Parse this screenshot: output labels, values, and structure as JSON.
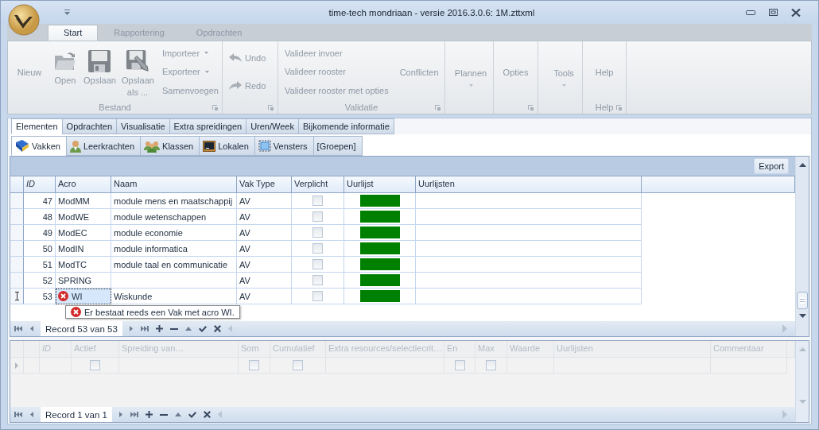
{
  "window": {
    "title": "time-tech mondriaan - versie 2016.3.0.6: 1M.zttxml"
  },
  "ribbon": {
    "tabs": [
      {
        "label": "Start",
        "selected": true
      },
      {
        "label": "Rapportering",
        "selected": false
      },
      {
        "label": "Opdrachten",
        "selected": false
      }
    ],
    "groups": [
      {
        "caption": "Bestand",
        "launcher": true,
        "columns": [
          [
            {
              "kind": "text",
              "label": "Nieuw"
            }
          ],
          [
            {
              "kind": "large",
              "label": "Open"
            }
          ],
          [
            {
              "kind": "large",
              "label": "Opslaan"
            }
          ],
          [
            {
              "kind": "large",
              "label": "Opslaan als ..."
            }
          ],
          [
            {
              "kind": "menu",
              "label": "Importeer"
            },
            {
              "kind": "menu",
              "label": "Exporteer"
            },
            {
              "kind": "small",
              "label": "Samenvoegen"
            }
          ]
        ]
      },
      {
        "launcher": true,
        "columns": [
          [
            {
              "kind": "undo",
              "label": "Undo"
            },
            {
              "kind": "redo",
              "label": "Redo"
            }
          ]
        ]
      },
      {
        "caption": "Validatie",
        "launcher": true,
        "columns": [
          [
            {
              "kind": "small",
              "label": "Valideer invoer"
            },
            {
              "kind": "small",
              "label": "Valideer rooster"
            },
            {
              "kind": "small",
              "label": "Valideer rooster met opties"
            }
          ],
          [
            {
              "kind": "small",
              "label": "Conflicten"
            }
          ]
        ]
      },
      {
        "launcher": false,
        "columns": [
          [
            {
              "kind": "bigmenu",
              "label": "Plannen"
            }
          ]
        ]
      },
      {
        "launcher": true,
        "columns": [
          [
            {
              "kind": "text",
              "label": "Opties"
            }
          ]
        ]
      },
      {
        "launcher": false,
        "columns": [
          [
            {
              "kind": "bigmenu",
              "label": "Tools"
            }
          ]
        ]
      },
      {
        "caption": "Help",
        "launcher": true,
        "columns": [
          [
            {
              "kind": "text",
              "label": "Help"
            }
          ]
        ]
      }
    ]
  },
  "main_tabs": [
    {
      "label": "Elementen",
      "selected": true
    },
    {
      "label": "Opdrachten",
      "selected": false
    },
    {
      "label": "Visualisatie",
      "selected": false
    },
    {
      "label": "Extra spreidingen",
      "selected": false
    },
    {
      "label": "Uren/Week",
      "selected": false
    },
    {
      "label": "Bijkomende informatie",
      "selected": false
    }
  ],
  "sub_tabs": [
    {
      "label": "Vakken",
      "selected": true
    },
    {
      "label": "Leerkrachten",
      "selected": false
    },
    {
      "label": "Klassen",
      "selected": false
    },
    {
      "label": "Lokalen",
      "selected": false
    },
    {
      "label": "Vensters",
      "selected": false
    },
    {
      "label": "[Groepen]",
      "selected": false
    }
  ],
  "grid": {
    "export_button": "Export",
    "columns": [
      "ID",
      "Acro",
      "Naam",
      "Vak Type",
      "Verplicht",
      "Uurlijst",
      "Uurlijsten"
    ],
    "rows": [
      {
        "id": "47",
        "acro": "ModMM",
        "naam": "module mens en maatschappij",
        "vak_type": "AV",
        "verplicht": false,
        "current": false,
        "error": false
      },
      {
        "id": "48",
        "acro": "ModWE",
        "naam": "module wetenschappen",
        "vak_type": "AV",
        "verplicht": false,
        "current": false,
        "error": false
      },
      {
        "id": "49",
        "acro": "ModEC",
        "naam": "module economie",
        "vak_type": "AV",
        "verplicht": false,
        "current": false,
        "error": false
      },
      {
        "id": "50",
        "acro": "ModIN",
        "naam": "module informatica",
        "vak_type": "AV",
        "verplicht": false,
        "current": false,
        "error": false
      },
      {
        "id": "51",
        "acro": "ModTC",
        "naam": "module taal en communicatie",
        "vak_type": "AV",
        "verplicht": false,
        "current": false,
        "error": false
      },
      {
        "id": "52",
        "acro": "SPRING",
        "vak_type": "AV",
        "verplicht": false,
        "current": false,
        "error": false
      },
      {
        "id": "53",
        "acro": "WI",
        "naam": "Wiskunde",
        "vak_type": "AV",
        "verplicht": false,
        "current": true,
        "error": true
      }
    ],
    "error_tooltip": "Er bestaat reeds een Vak met acro WI.",
    "record": "Record 53 van 53"
  },
  "lower_grid": {
    "disabled": true,
    "columns": [
      {
        "label": "ID",
        "kind": "text"
      },
      {
        "label": "Actief",
        "kind": "check"
      },
      {
        "label": "Spreiding van…",
        "kind": "text"
      },
      {
        "label": "Som",
        "kind": "check"
      },
      {
        "label": "Cumulatief",
        "kind": "check"
      },
      {
        "label": "Extra resources/selectiecrit…",
        "kind": "text"
      },
      {
        "label": "En",
        "kind": "check"
      },
      {
        "label": "Max",
        "kind": "check"
      },
      {
        "label": "Waarde",
        "kind": "text"
      },
      {
        "label": "Uurlijsten",
        "kind": "text"
      },
      {
        "label": "Commentaar",
        "kind": "text"
      }
    ],
    "rows": [
      {
        "current": true,
        "checks": [
          false,
          false,
          false,
          false,
          false
        ]
      }
    ],
    "record": "Record 1 van 1"
  }
}
